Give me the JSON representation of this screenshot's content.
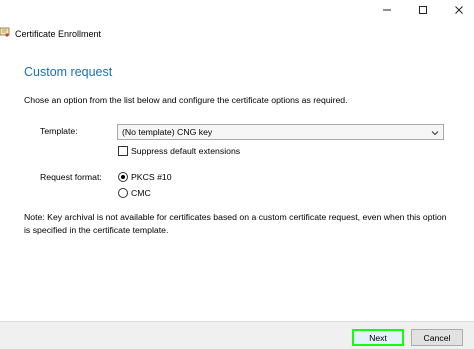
{
  "window": {
    "title": "Certificate Enrollment",
    "controls": [
      "minimize-icon",
      "maximize-icon",
      "close-icon"
    ]
  },
  "page": {
    "title": "Custom request",
    "instructions": "Chose an option from the list below and configure the certificate options as required."
  },
  "form": {
    "template_label": "Template:",
    "template_value": "(No template) CNG key",
    "suppress_label": "Suppress default extensions",
    "suppress_checked": false,
    "request_format_label": "Request format:",
    "formats": [
      {
        "label": "PKCS #10",
        "selected": true
      },
      {
        "label": "CMC",
        "selected": false
      }
    ]
  },
  "note": "Note: Key archival is not available for certificates based on a custom certificate request, even when this option is specified in the certificate template.",
  "footer": {
    "next_label": "Next",
    "cancel_label": "Cancel"
  },
  "colors": {
    "title_blue": "#1c6fb8",
    "highlight_green": "#12ff12"
  }
}
